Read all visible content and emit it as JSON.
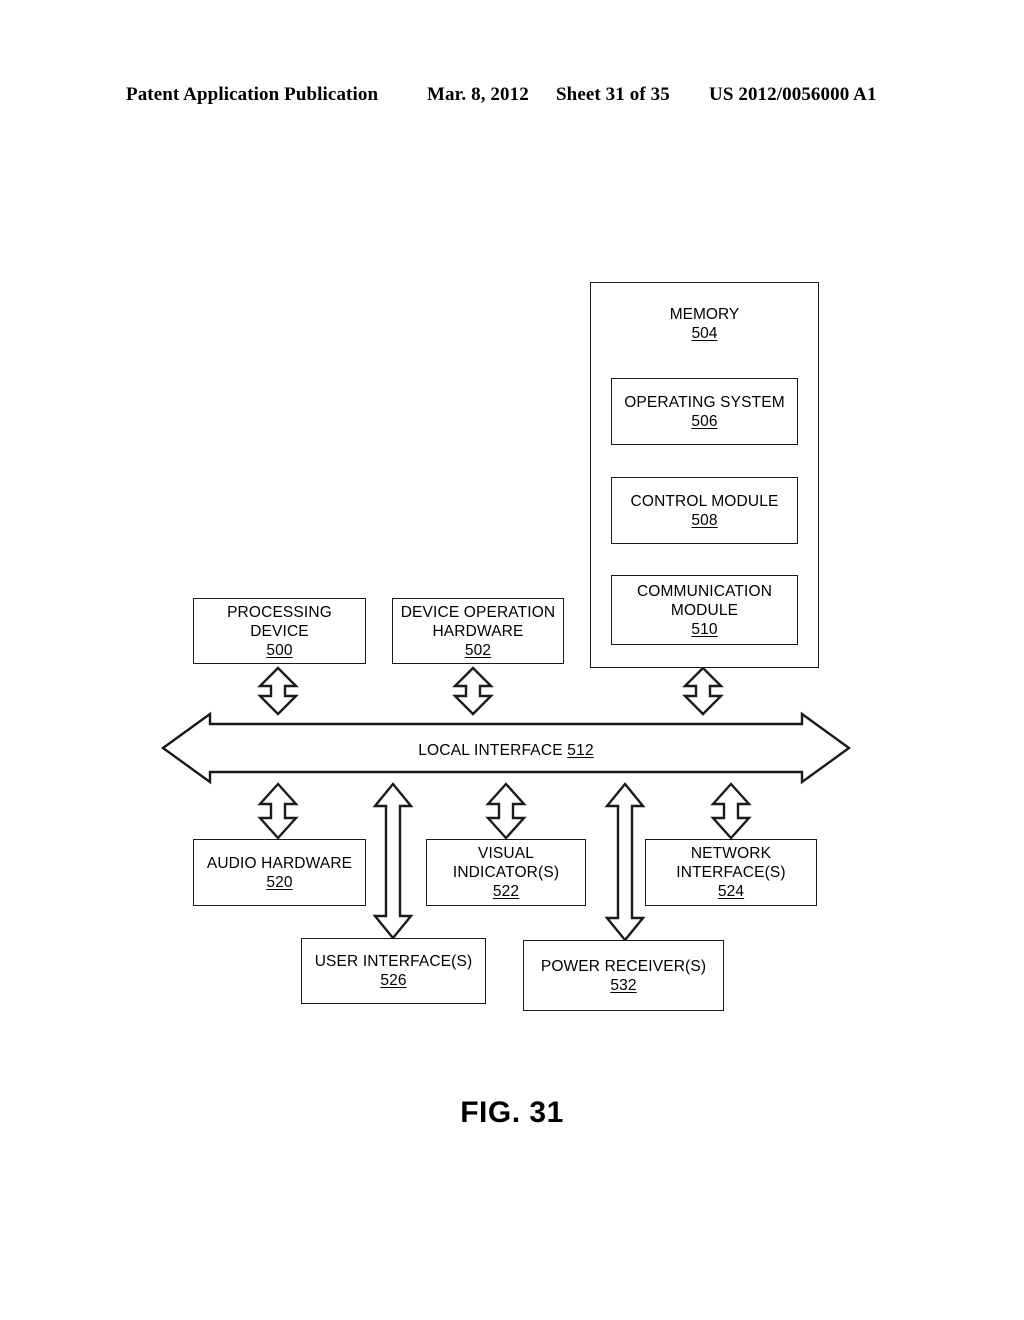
{
  "header": {
    "publication": "Patent Application Publication",
    "date": "Mar. 8, 2012",
    "sheet": "Sheet 31 of 35",
    "doc_number": "US 2012/0056000 A1"
  },
  "figure": {
    "caption": "FIG. 31",
    "memory": {
      "label": "MEMORY",
      "refnum": "504",
      "modules": [
        {
          "label": "OPERATING SYSTEM",
          "refnum": "506"
        },
        {
          "label": "CONTROL MODULE",
          "refnum": "508"
        },
        {
          "label": "COMMUNICATION\nMODULE",
          "refnum": "510"
        }
      ]
    },
    "bus": {
      "label": "LOCAL INTERFACE",
      "refnum": "512"
    },
    "upper_row": [
      {
        "label": "PROCESSING\nDEVICE",
        "refnum": "500"
      },
      {
        "label": "DEVICE OPERATION\nHARDWARE",
        "refnum": "502"
      }
    ],
    "middle_row": [
      {
        "label": "AUDIO HARDWARE",
        "refnum": "520"
      },
      {
        "label": "VISUAL\nINDICATOR(S)",
        "refnum": "522"
      },
      {
        "label": "NETWORK\nINTERFACE(S)",
        "refnum": "524"
      }
    ],
    "bottom_row": [
      {
        "label": "USER INTERFACE(S)",
        "refnum": "526"
      },
      {
        "label": "POWER RECEIVER(S)",
        "refnum": "532"
      }
    ]
  },
  "colors": {
    "ink": "#1a1a1a",
    "paper": "#ffffff"
  }
}
